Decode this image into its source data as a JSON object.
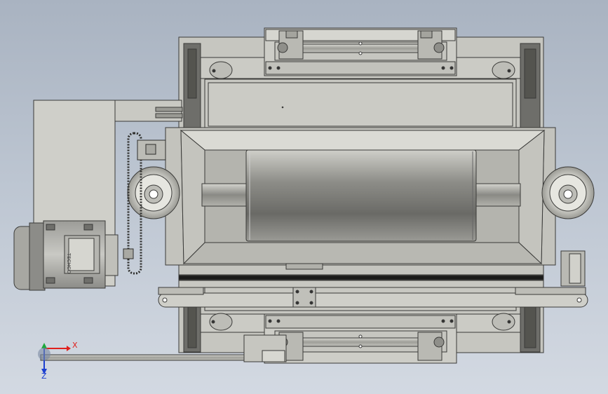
{
  "triad": {
    "x_label": "X",
    "y_label": "Y",
    "z_label": "Z",
    "x_color": "#e0201c",
    "y_color": "#1ca83a",
    "z_color": "#1c3fd0"
  },
  "model": {
    "motor_nameplate": "TECHCO"
  }
}
